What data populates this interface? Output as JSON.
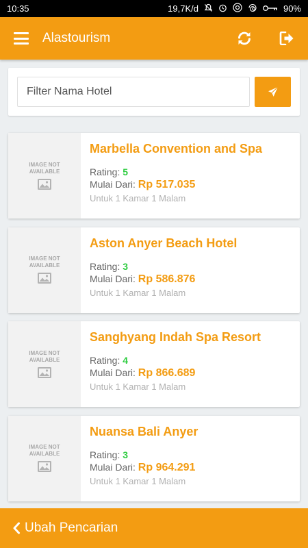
{
  "status_bar": {
    "time": "10:35",
    "network_speed": "19,7K/d",
    "battery": "90%"
  },
  "app_bar": {
    "title": "Alastourism"
  },
  "search": {
    "placeholder": "Filter Nama Hotel"
  },
  "hotel_list": {
    "placeholder_image_text": "IMAGE NOT AVAILABLE",
    "rating_label": "Rating:",
    "price_label": "Mulai Dari:",
    "unit_text": "Untuk 1 Kamar 1 Malam",
    "items": [
      {
        "name": "Marbella Convention and Spa",
        "rating": "5",
        "price": "Rp 517.035"
      },
      {
        "name": "Aston Anyer Beach Hotel",
        "rating": "3",
        "price": "Rp 586.876"
      },
      {
        "name": "Sanghyang Indah Spa Resort",
        "rating": "4",
        "price": "Rp 866.689"
      },
      {
        "name": "Nuansa Bali Anyer",
        "rating": "3",
        "price": "Rp 964.291"
      }
    ]
  },
  "bottom_bar": {
    "label": "Ubah Pencarian"
  },
  "colors": {
    "accent": "#f39c12",
    "rating": "#2ecc40",
    "background": "#eceff1"
  }
}
